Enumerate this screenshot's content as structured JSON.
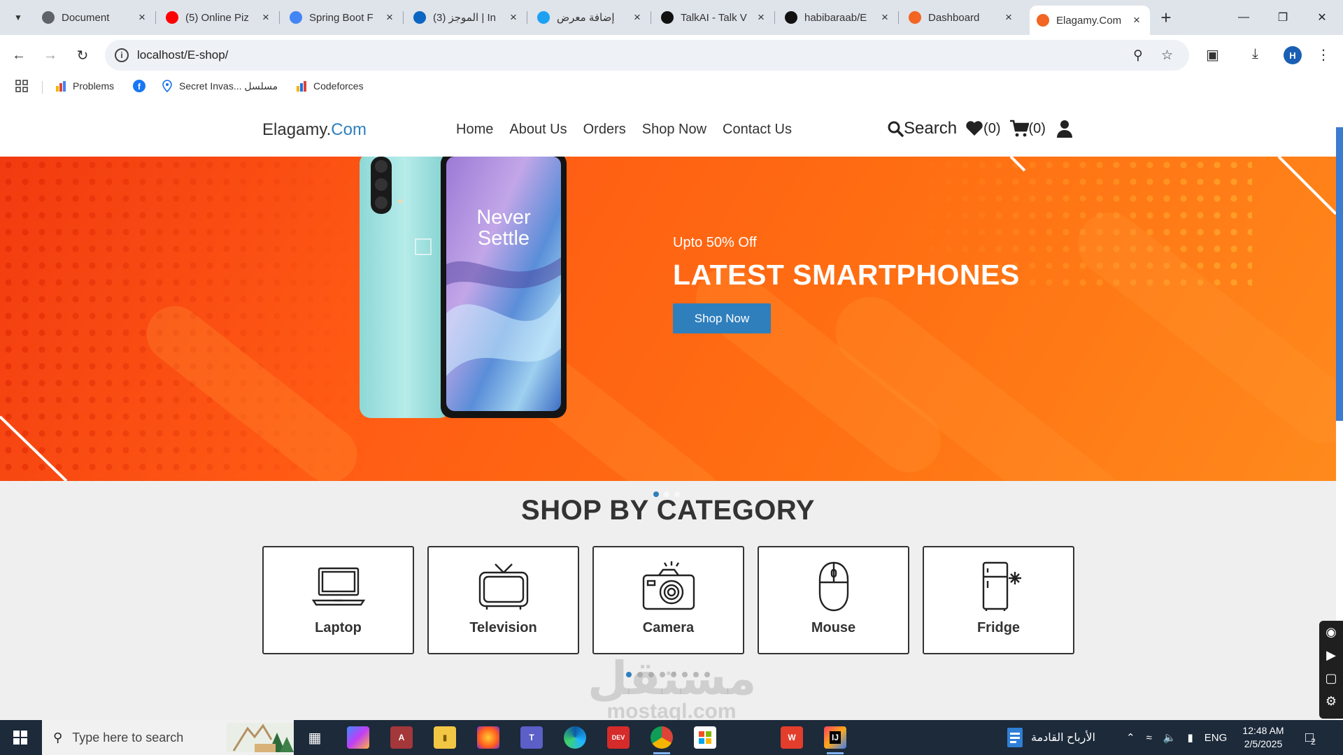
{
  "browser": {
    "tabs": [
      {
        "title": "Document",
        "favicon": "globe-icon",
        "color": "#5f6368"
      },
      {
        "title": "(5) Online Piz",
        "favicon": "youtube-icon",
        "color": "#ff0000"
      },
      {
        "title": "Spring Boot F",
        "favicon": "google-icon",
        "color": "#4285f4"
      },
      {
        "title": "(3) الموجز | In",
        "favicon": "linkedin-icon",
        "color": "#0a66c2"
      },
      {
        "title": "إضافة معرض",
        "favicon": "site-icon",
        "color": "#1da1f2"
      },
      {
        "title": "TalkAI - Talk V",
        "favicon": "chatgpt-icon",
        "color": "#111111"
      },
      {
        "title": "habibaraab/E",
        "favicon": "github-icon",
        "color": "#111111"
      },
      {
        "title": "Dashboard",
        "favicon": "xampp-icon",
        "color": "#f26522"
      },
      {
        "title": "Elagamy.Com",
        "favicon": "xampp-icon",
        "color": "#f26522",
        "active": true
      }
    ],
    "url": "localhost/E-shop/",
    "profile_initial": "H",
    "bookmarks": [
      {
        "label": "Problems",
        "icon": "chart-icon"
      },
      {
        "label": "",
        "icon": "facebook-icon"
      },
      {
        "label": "Secret Invas... مسلسل",
        "icon": "location-icon"
      },
      {
        "label": "Codeforces",
        "icon": "chart-icon"
      }
    ]
  },
  "site": {
    "brand_main": "Elagamy.",
    "brand_accent": "Com",
    "menu": [
      "Home",
      "About Us",
      "Orders",
      "Shop Now",
      "Contact Us"
    ],
    "search_label": "Search",
    "wishlist_count": "(0)",
    "cart_count": "(0)",
    "accent_color": "#2f7fbd",
    "hero": {
      "subtitle": "Upto 50% Off",
      "title": "LATEST SMARTPHONES",
      "button": "Shop Now",
      "phone_screen_text_1": "Never",
      "phone_screen_text_2": "Settle",
      "slides": 3,
      "active_slide": 1
    },
    "category_title": "SHOP BY CATEGORY",
    "categories": [
      {
        "label": "Laptop",
        "icon": "laptop-icon"
      },
      {
        "label": "Television",
        "icon": "television-icon"
      },
      {
        "label": "Camera",
        "icon": "camera-icon"
      },
      {
        "label": "Mouse",
        "icon": "mouse-icon"
      },
      {
        "label": "Fridge",
        "icon": "fridge-icon"
      }
    ],
    "category_pages": 8,
    "category_active_page": 1,
    "watermark_main": "مستقل",
    "watermark_sub": "mostaql.com"
  },
  "taskbar": {
    "search_placeholder": "Type here to search",
    "weather_text": "الأرباح القادمة",
    "language": "ENG",
    "time": "12:48 AM",
    "date": "2/5/2025",
    "notification_count": "2"
  }
}
